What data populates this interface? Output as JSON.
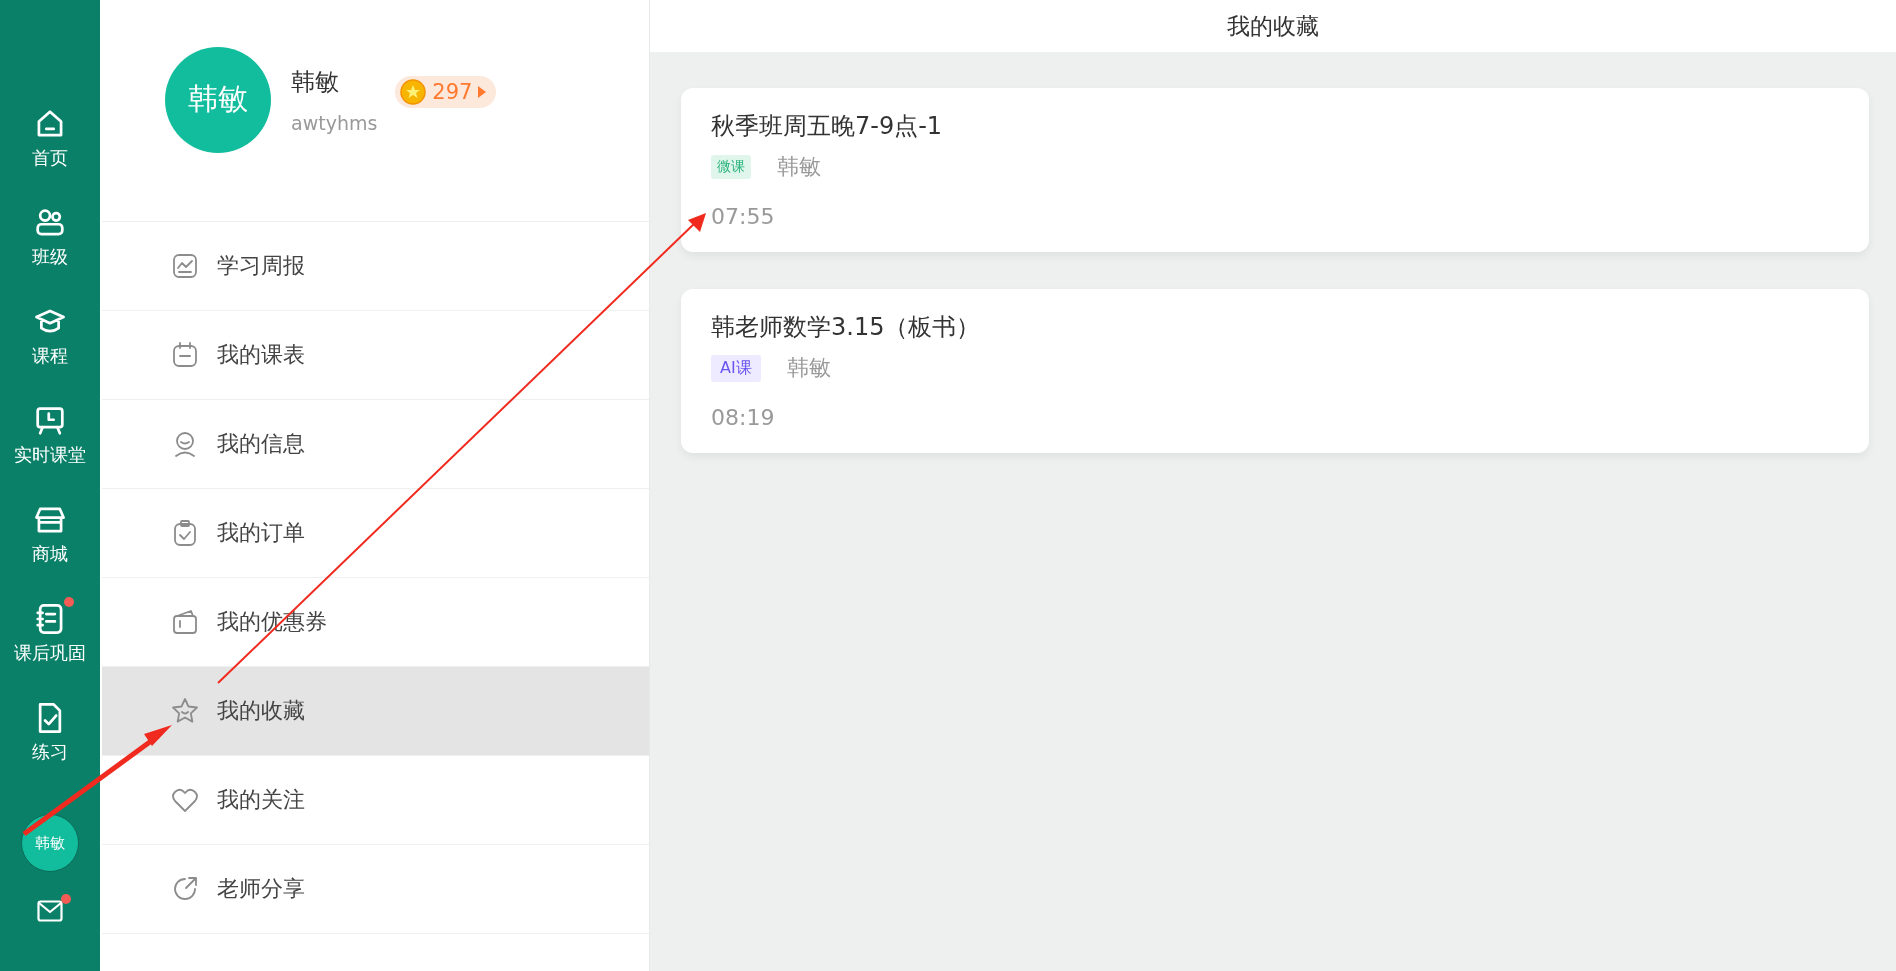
{
  "nav": {
    "items": [
      {
        "label": "首页",
        "badge": false
      },
      {
        "label": "班级",
        "badge": false
      },
      {
        "label": "课程",
        "badge": false
      },
      {
        "label": "实时课堂",
        "badge": false
      },
      {
        "label": "商城",
        "badge": false
      },
      {
        "label": "课后巩固",
        "badge": true
      },
      {
        "label": "练习",
        "badge": false
      }
    ],
    "avatar": "韩敏",
    "mail_badge": true
  },
  "profile": {
    "avatar": "韩敏",
    "name": "韩敏",
    "username": "awtyhms",
    "coins": "297"
  },
  "menu": [
    {
      "label": "学习周报",
      "selected": false
    },
    {
      "label": "我的课表",
      "selected": false
    },
    {
      "label": "我的信息",
      "selected": false
    },
    {
      "label": "我的订单",
      "selected": false
    },
    {
      "label": "我的优惠券",
      "selected": false
    },
    {
      "label": "我的收藏",
      "selected": true
    },
    {
      "label": "我的关注",
      "selected": false
    },
    {
      "label": "老师分享",
      "selected": false
    }
  ],
  "header": {
    "title": "我的收藏"
  },
  "favorites": [
    {
      "title": "秋季班周五晚7-9点-1",
      "tag": "微课",
      "kind": "micro",
      "teacher": "韩敏",
      "time": "07:55"
    },
    {
      "title": "韩老师数学3.15（板书）",
      "tag": "AI课",
      "kind": "ai",
      "teacher": "韩敏",
      "time": "08:19"
    }
  ]
}
